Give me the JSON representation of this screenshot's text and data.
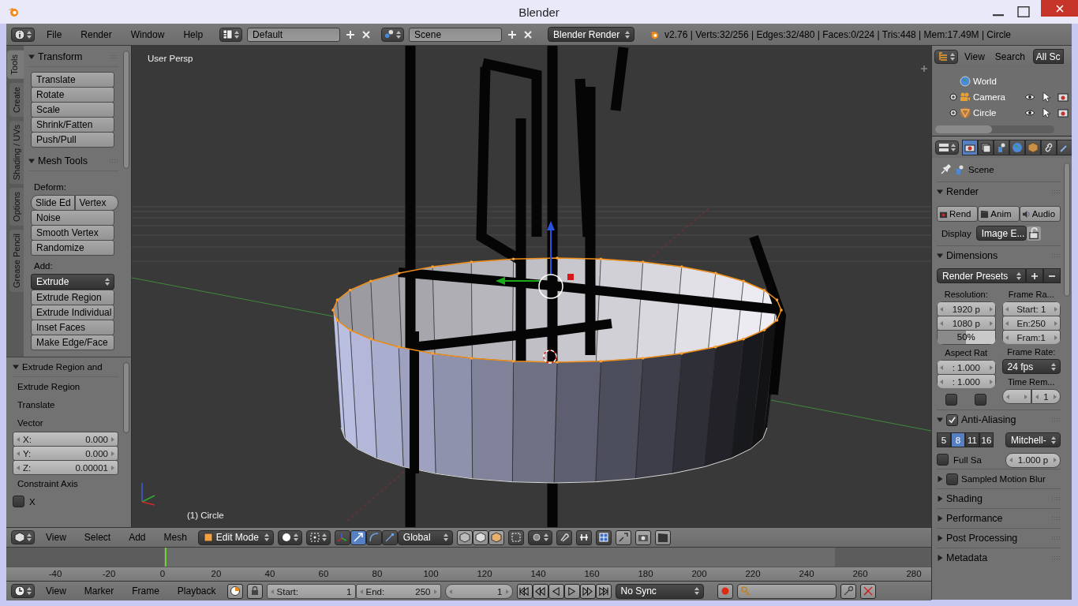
{
  "window": {
    "title": "Blender"
  },
  "info_header": {
    "menus": [
      "File",
      "Render",
      "Window",
      "Help"
    ],
    "screen_layout": "Default",
    "scene": "Scene",
    "render_engine": "Blender Render",
    "stats": "v2.76 | Verts:32/256 | Edges:32/480 | Faces:0/224 | Tris:448 | Mem:17.49M | Circle"
  },
  "tool_shelf": {
    "tabs": [
      {
        "label": "Tools",
        "selected": true
      },
      {
        "label": "Create",
        "selected": false
      },
      {
        "label": "Shading / UVs",
        "selected": false
      },
      {
        "label": "Options",
        "selected": false
      },
      {
        "label": "Grease Pencil",
        "selected": false
      }
    ],
    "panels": [
      {
        "title": "Transform",
        "expanded": true,
        "items": [
          {
            "kind": "button",
            "label": "Translate"
          },
          {
            "kind": "button",
            "label": "Rotate"
          },
          {
            "kind": "button",
            "label": "Scale"
          },
          {
            "kind": "button",
            "label": "Shrink/Fatten"
          },
          {
            "kind": "button",
            "label": "Push/Pull"
          }
        ]
      },
      {
        "title": "Mesh Tools",
        "expanded": true,
        "items": [
          {
            "kind": "heading",
            "label": "Deform:"
          },
          {
            "kind": "pair",
            "labels": [
              "Slide Ed",
              "Vertex"
            ]
          },
          {
            "kind": "button",
            "label": "Noise"
          },
          {
            "kind": "button",
            "label": "Smooth Vertex"
          },
          {
            "kind": "button",
            "label": "Randomize"
          },
          {
            "kind": "heading",
            "label": "Add:"
          },
          {
            "kind": "dropdown",
            "label": "Extrude"
          },
          {
            "kind": "button",
            "label": "Extrude Region"
          },
          {
            "kind": "button",
            "label": "Extrude Individual"
          },
          {
            "kind": "button",
            "label": "Inset Faces"
          },
          {
            "kind": "button",
            "label": "Make Edge/Face"
          }
        ]
      }
    ]
  },
  "operator_panel": {
    "title": "Extrude Region and",
    "expanded": true,
    "items": [
      {
        "kind": "label",
        "label": "Extrude Region"
      },
      {
        "kind": "label",
        "label": "Translate"
      },
      {
        "kind": "label",
        "label": "Vector"
      },
      {
        "kind": "number",
        "label": "X:",
        "value": "0.000"
      },
      {
        "kind": "number",
        "label": "Y:",
        "value": "0.000"
      },
      {
        "kind": "number",
        "label": "Z:",
        "value": "0.00001"
      },
      {
        "kind": "label",
        "label": "Constraint Axis"
      },
      {
        "kind": "checkbox",
        "label": "X",
        "checked": false
      }
    ]
  },
  "viewport": {
    "view_name": "User Persp",
    "object_name": "(1) Circle"
  },
  "view3d_header": {
    "menus": [
      "View",
      "Select",
      "Add",
      "Mesh"
    ],
    "mode": "Edit Mode",
    "orientation": "Global"
  },
  "timeline": {
    "frame_labels": [
      "-40",
      "-20",
      "0",
      "20",
      "40",
      "60",
      "80",
      "100",
      "120",
      "140",
      "160",
      "180",
      "200",
      "220",
      "240",
      "260",
      "280"
    ]
  },
  "timeline_header": {
    "menus": [
      "View",
      "Marker",
      "Frame",
      "Playback"
    ],
    "start": {
      "label": "Start:",
      "value": "1"
    },
    "end": {
      "label": "End:",
      "value": "250"
    },
    "current_frame": "1",
    "sync": "No Sync"
  },
  "outliner": {
    "menus": [
      "View",
      "Search"
    ],
    "filter": "All Sc",
    "items": [
      {
        "kind": "world",
        "label": "World"
      },
      {
        "kind": "camera",
        "label": "Camera",
        "expanded": false
      },
      {
        "kind": "mesh",
        "label": "Circle",
        "expanded": false
      }
    ]
  },
  "properties": {
    "tabs": [
      {
        "kind": "render",
        "selected": true
      },
      {
        "kind": "layers",
        "selected": false
      },
      {
        "kind": "scene",
        "selected": false
      },
      {
        "kind": "world",
        "selected": false
      },
      {
        "kind": "object",
        "selected": false
      },
      {
        "kind": "constraints",
        "selected": false
      },
      {
        "kind": "modifiers",
        "selected": false
      }
    ],
    "context": "Scene",
    "render": {
      "title": "Render",
      "expanded": true,
      "buttons": [
        "Rend",
        "Anim",
        "Audio"
      ],
      "display_label": "Display",
      "display": "Image E..."
    },
    "dimensions": {
      "title": "Dimensions",
      "expanded": true,
      "presets": "Render Presets",
      "resolution_label": "Resolution:",
      "resolution_x": "1920 p",
      "resolution_y": "1080 p",
      "percentage": {
        "text": "50%",
        "level": 0.5
      },
      "frame_range_label": "Frame Ra...",
      "frame_start": "Start: 1",
      "frame_end": "En:250",
      "frame_step": "Fram:1",
      "aspect_label": "Aspect Rat",
      "aspect_x": ": 1.000",
      "aspect_y": ": 1.000",
      "frame_rate_label": "Frame Rate:",
      "frame_rate": "24 fps",
      "time_remap_label": "Time Rem...",
      "time_remap_new": "1",
      "border": false,
      "crop": false
    },
    "anti_aliasing": {
      "title": "Anti-Aliasing",
      "expanded": true,
      "enabled": true,
      "samples": [
        {
          "label": "5",
          "selected": false
        },
        {
          "label": "8",
          "selected": true
        },
        {
          "label": "11",
          "selected": false
        },
        {
          "label": "16",
          "selected": false
        }
      ],
      "filter": "Mitchell-",
      "full_sample": {
        "label": "Full Sa",
        "checked": false
      },
      "filter_size": "1.000 p"
    },
    "collapsed_panels": [
      {
        "kind": "checkbox",
        "title": "Sampled Motion Blur",
        "expanded": false,
        "checked": false
      },
      {
        "kind": "plain",
        "title": "Shading",
        "expanded": false
      },
      {
        "kind": "plain",
        "title": "Performance",
        "expanded": false
      },
      {
        "kind": "plain",
        "title": "Post Processing",
        "expanded": false
      },
      {
        "kind": "plain",
        "title": "Metadata",
        "expanded": false
      }
    ]
  }
}
